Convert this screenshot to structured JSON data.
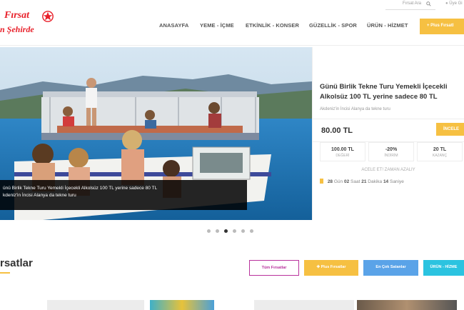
{
  "header": {
    "logo_line1": "Fırsat",
    "logo_line2": "n Şehirde",
    "search_placeholder": "Fırsat Ara",
    "login_label": "Üye Gi",
    "nav": [
      "ANASAYFA",
      "YEME - İÇME",
      "ETKİNLİK - KONSER",
      "GÜZELLİK - SPOR",
      "ÜRÜN - HİZMET"
    ],
    "plus_button": "+ Plus Fırsatl"
  },
  "slide": {
    "caption_line1": "ünü Birlik Tekne Turu Yemekli İçecekli Alkolsüz 100 TL yerine sadece 80 TL",
    "caption_line2": "kdeniz'in İncisi Alanya da tekne turu",
    "active_dot": 3
  },
  "deal": {
    "title": "Günü Birlik Tekne Turu Yemekli İçecekli Alkolsüz 100 TL yerine sadece 80 TL",
    "subtitle": "Akdeniz'in İncisi Alanya da tekne turu",
    "price": "80.00 TL",
    "cta": "İNCELE",
    "stats": [
      {
        "value": "100.00 TL",
        "label": "DEĞERİ"
      },
      {
        "value": "-20%",
        "label": "İNDİRİM"
      },
      {
        "value": "20 TL",
        "label": "KAZANÇ"
      }
    ],
    "hurry": "ACELE ET! ZAMAN AZALIY",
    "countdown": {
      "days": "28",
      "days_label": "Gün",
      "hours": "02",
      "hours_label": "Saat",
      "minutes": "21",
      "minutes_label": "Dakika",
      "seconds": "14",
      "seconds_label": "Saniye"
    }
  },
  "section": {
    "title": "rsatlar",
    "filters": [
      {
        "label": "Tüm Fırsatlar",
        "color": "#b8329c"
      },
      {
        "label": "✚ Plus Fırsatlar",
        "color": "#f6c042"
      },
      {
        "label": "En Çok Satanlar",
        "color": "#5aa3e8"
      },
      {
        "label": "ÜRÜN - HİZME",
        "color": "#2bc3e0"
      }
    ]
  },
  "colors": {
    "brand_red": "#e8202a",
    "accent_yellow": "#f6c042"
  }
}
